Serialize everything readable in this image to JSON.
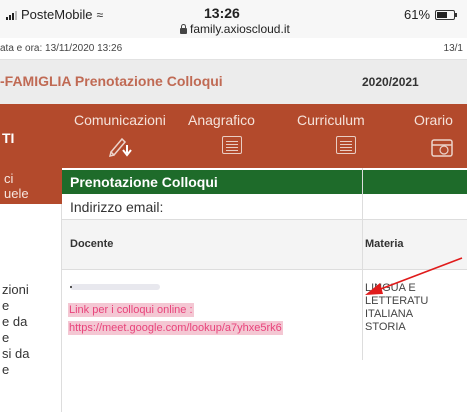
{
  "status_bar": {
    "carrier": "PosteMobile",
    "time": "13:26",
    "url": "family.axioscloud.it",
    "battery": "61%"
  },
  "date_row": {
    "left": "ata e ora: 13/11/2020 13:26",
    "right": "13/1"
  },
  "title_bar": {
    "title": "-FAMIGLIA Prenotazione Colloqui",
    "year": "2020/2021"
  },
  "nav": {
    "left_label": "TI",
    "items": [
      {
        "label": "Comunicazioni",
        "icon": "pen-download-icon"
      },
      {
        "label": "Anagrafico",
        "icon": "document-icon"
      },
      {
        "label": "Curriculum",
        "icon": "document-icon"
      },
      {
        "label": "Orario",
        "icon": "calendar-icon"
      }
    ]
  },
  "left_menu": {
    "top_lines": [
      "ci",
      "uele"
    ],
    "lines": [
      "zioni",
      "e",
      "e da",
      "e",
      "si da",
      "e"
    ]
  },
  "panel": {
    "title": "Prenotazione Colloqui",
    "email_label": "Indirizzo email:"
  },
  "table": {
    "columns": [
      "Docente",
      "Materia"
    ],
    "row": {
      "link_label": "Link per i colloqui online :",
      "link_url": "https://meet.google.com/lookup/a7yhxe5rk6",
      "materia_lines": [
        "LINGUA E",
        "LETTERATU",
        "ITALIANA",
        "STORIA"
      ]
    }
  },
  "colors": {
    "nav_background": "#b34a2c",
    "title_accent": "#c06a54",
    "panel_green": "#1e6b2a",
    "link_text": "#e8437b",
    "link_highlight": "#f4c7d3",
    "annotation_arrow": "#e01b1b"
  }
}
